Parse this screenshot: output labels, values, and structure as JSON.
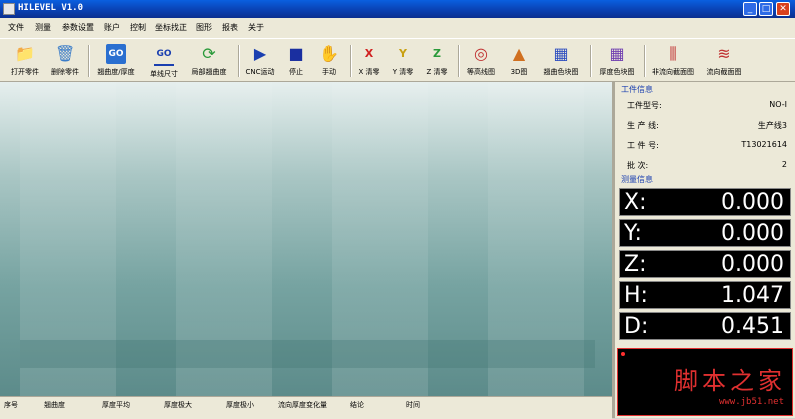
{
  "window": {
    "title": "HILEVEL  V1.0"
  },
  "menu": [
    "文件",
    "测量",
    "参数设置",
    "账户",
    "控制",
    "坐标找正",
    "图形",
    "报表",
    "关于"
  ],
  "toolbar": [
    {
      "label": "打开零件",
      "icon": "folder-icon"
    },
    {
      "label": "删除零件",
      "icon": "trash-icon"
    },
    {
      "label": "翘曲度/厚度",
      "icon": "go-icon"
    },
    {
      "label": "单线尺寸",
      "icon": "go-line-icon"
    },
    {
      "label": "局部翘曲度",
      "icon": "refresh-icon"
    },
    {
      "label": "CNC运动",
      "icon": "play-icon"
    },
    {
      "label": "停止",
      "icon": "stop-icon"
    },
    {
      "label": "手动",
      "icon": "hand-icon"
    },
    {
      "label": "X 清零",
      "icon": "x-reset-icon"
    },
    {
      "label": "Y 清零",
      "icon": "y-reset-icon"
    },
    {
      "label": "Z 清零",
      "icon": "z-reset-icon"
    },
    {
      "label": "等高线图",
      "icon": "contour-icon"
    },
    {
      "label": "3D图",
      "icon": "3d-icon"
    },
    {
      "label": "翘曲色块图",
      "icon": "warp-grid-icon"
    },
    {
      "label": "厚度色块图",
      "icon": "thickness-grid-icon"
    },
    {
      "label": "非流向截面图",
      "icon": "nonflow-section-icon"
    },
    {
      "label": "流向截面图",
      "icon": "flow-section-icon"
    }
  ],
  "table_headers": [
    "序号",
    "翘曲度",
    "厚度平均",
    "厚度极大",
    "厚度极小",
    "流向厚度变化量",
    "结论",
    "时间"
  ],
  "panel": {
    "info_title": "工件信息",
    "info": [
      {
        "label": "工件型号:",
        "value": "NO-I"
      },
      {
        "label": "生 产 线:",
        "value": "生产线3"
      },
      {
        "label": "工 件 号:",
        "value": "T13021614"
      },
      {
        "label": "批    次:",
        "value": "2"
      }
    ],
    "measure_title": "测量信息",
    "readouts": [
      {
        "axis": "X:",
        "value": "0.000"
      },
      {
        "axis": "Y:",
        "value": "0.000"
      },
      {
        "axis": "Z:",
        "value": "0.000"
      },
      {
        "axis": "H:",
        "value": "1.047"
      },
      {
        "axis": "D:",
        "value": "0.451"
      }
    ]
  },
  "watermark": {
    "text": "脚本之家",
    "url": "www.jb51.net"
  },
  "colors": {
    "titlebar": "#0a3fb0",
    "section_title": "#1a3fb0",
    "watermark": "#e03030"
  }
}
